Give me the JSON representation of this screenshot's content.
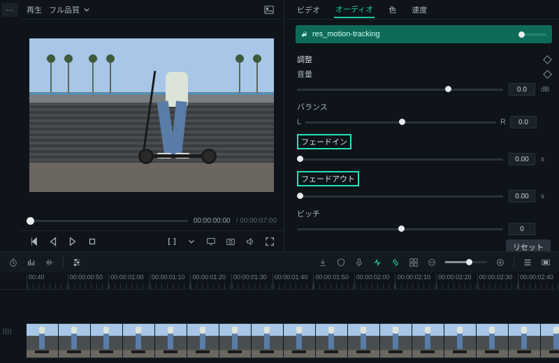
{
  "preview": {
    "play_label": "再生",
    "quality_label": "フル品質",
    "time_current": "00:00:00:00",
    "time_total": "00:00:07:00"
  },
  "tabs": {
    "video": "ビデオ",
    "audio": "オーディオ",
    "color": "色",
    "speed": "速度"
  },
  "clip": {
    "name": "res_motion-tracking"
  },
  "audio_panel": {
    "adjust": "調整",
    "volume": "音量",
    "volume_val": "0.0",
    "volume_unit": "dB",
    "balance": "バランス",
    "L": "L",
    "R": "R",
    "balance_val": "0.0",
    "fade_in": "フェードイン",
    "fade_in_val": "0.00",
    "fade_in_unit": "s",
    "fade_out": "フェードアウト",
    "fade_out_val": "0.00",
    "fade_out_unit": "s",
    "pitch": "ビッチ",
    "pitch_val": "0",
    "reset": "リセット"
  },
  "ruler": [
    "00:40",
    "00:00:00:50",
    "00:00:01:00",
    "00:00:01:10",
    "00:00:01:20",
    "00:00:01:30",
    "00:00:01:40",
    "00:00:01:50",
    "00:00:02:00",
    "00:00:02:10",
    "00:00:02:20",
    "00:00:02:30",
    "00:00:02:40"
  ],
  "timeline_row_label": "||||"
}
